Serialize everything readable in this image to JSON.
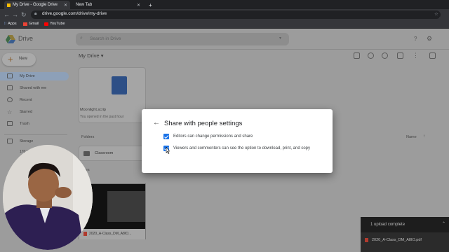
{
  "browser": {
    "tabs": [
      {
        "label": "My Drive - Google Drive",
        "active": true
      },
      {
        "label": "New Tab",
        "active": false
      }
    ],
    "url": "drive.google.com/drive/my-drive",
    "bookmarks": [
      "Apps",
      "Gmail",
      "YouTube"
    ]
  },
  "drive": {
    "logo_text": "Drive",
    "search_placeholder": "Search in Drive",
    "new_label": "New",
    "breadcrumb": "My Drive",
    "sidebar": [
      {
        "label": "My Drive",
        "icon": "drive-icon"
      },
      {
        "label": "Shared with me",
        "icon": "people-icon"
      },
      {
        "label": "Recent",
        "icon": "clock-icon"
      },
      {
        "label": "Starred",
        "icon": "star-icon"
      },
      {
        "label": "Trash",
        "icon": "trash-icon"
      }
    ],
    "storage_label": "Storage",
    "storage_used": "170 MB used",
    "quick_access": {
      "name": "Moonlight.scrip",
      "subtitle": "You opened in the past hour"
    },
    "folders_label": "Folders",
    "sort_label": "Name",
    "folder_name": "Classroom",
    "files_label": "Files",
    "file_name": "2020_A-Class_DM_A8IO...",
    "upload": {
      "status": "1 upload complete",
      "file": "2020_A-Class_DM_A8IO.pdf"
    }
  },
  "dialog": {
    "title": "Share with people settings",
    "options": [
      {
        "label": "Editors can change permissions and share",
        "checked": true
      },
      {
        "label": "Viewers and commenters can see the option to download, print, and copy",
        "checked": true
      }
    ]
  },
  "colors": {
    "accent": "#1a73e8",
    "doc": "#2d4f86"
  }
}
